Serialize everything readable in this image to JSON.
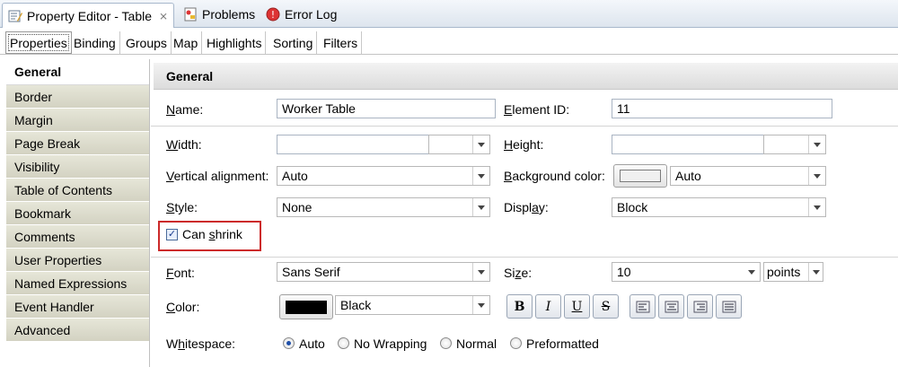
{
  "view_tabs": [
    {
      "label": "Property Editor - Table",
      "icon": "property-editor-icon",
      "active": true
    },
    {
      "label": "Problems",
      "icon": "problems-icon"
    },
    {
      "label": "Error Log",
      "icon": "error-log-icon"
    }
  ],
  "category_tabs": [
    "Properties",
    "Binding",
    "Groups",
    "Map",
    "Highlights",
    "Sorting",
    "Filters"
  ],
  "sidebar": {
    "items": [
      "General",
      "Border",
      "Margin",
      "Page Break",
      "Visibility",
      "Table of Contents",
      "Bookmark",
      "Comments",
      "User Properties",
      "Named Expressions",
      "Event Handler",
      "Advanced"
    ]
  },
  "section_title": "General",
  "form": {
    "name_label_u": "N",
    "name_label_rest": "ame:",
    "name_value": "Worker Table",
    "element_id_label_u": "E",
    "element_id_label_rest": "lement ID:",
    "element_id_value": "11",
    "width_label_u": "W",
    "width_label_rest": "idth:",
    "height_label_u": "H",
    "height_label_rest": "eight:",
    "valign_label_u": "V",
    "valign_label_rest": "ertical alignment:",
    "valign_value": "Auto",
    "bgcolor_label_u": "B",
    "bgcolor_label_rest": "ackground color:",
    "bgcolor_value": "Auto",
    "style_label_u": "S",
    "style_label_rest": "tyle:",
    "style_value": "None",
    "display_label_pre": "Displ",
    "display_label_u": "a",
    "display_label_post": "y:",
    "display_value": "Block",
    "can_shrink_pre": "Can ",
    "can_shrink_u": "s",
    "can_shrink_post": "hrink",
    "can_shrink_checked": true,
    "font_label_u": "F",
    "font_label_rest": "ont:",
    "font_value": "Sans Serif",
    "size_label_pre": "Si",
    "size_label_u": "z",
    "size_label_post": "e:",
    "size_value": "10",
    "size_unit": "points",
    "color_label_u": "C",
    "color_label_rest": "olor:",
    "color_value": "Black",
    "color_swatch": "#000000",
    "format_buttons": [
      "B",
      "I",
      "U",
      "S"
    ],
    "whitespace_label_pre": "W",
    "whitespace_label_u": "h",
    "whitespace_label_post": "itespace:",
    "whitespace_options": [
      "Auto",
      "No Wrapping",
      "Normal",
      "Preformatted"
    ],
    "whitespace_selected": "Auto"
  },
  "colors": {
    "highlight_border": "#cc2a2a",
    "sidebar_bg": "#d9d8c8",
    "tab_border": "#a8b8cc"
  }
}
